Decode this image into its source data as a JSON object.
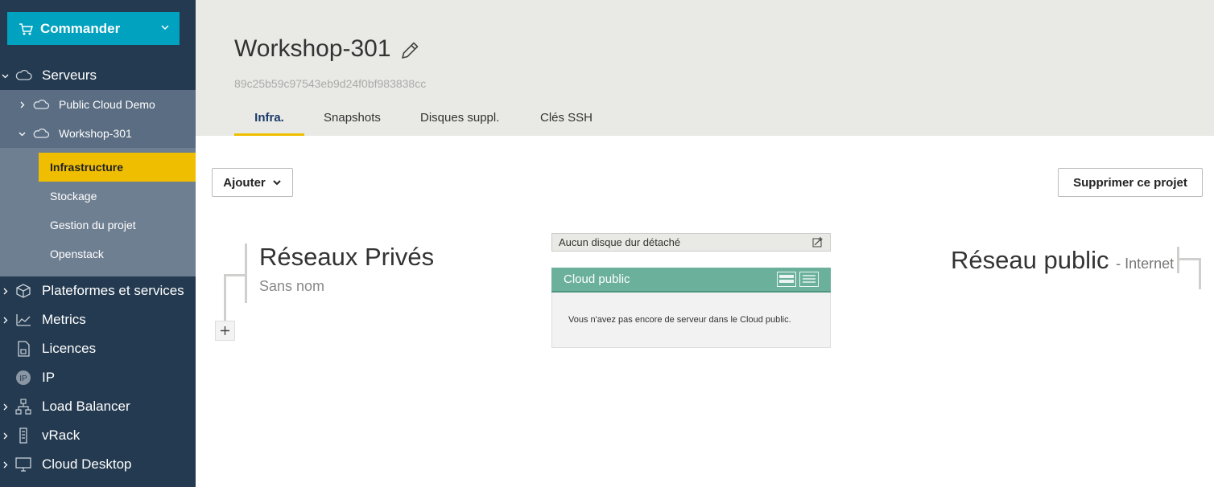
{
  "sidebar": {
    "order_button": "Commander",
    "items": [
      {
        "label": "Serveurs"
      },
      {
        "label": "Public Cloud Demo"
      },
      {
        "label": "Workshop-301"
      },
      {
        "label": "Infrastructure"
      },
      {
        "label": "Stockage"
      },
      {
        "label": "Gestion du projet"
      },
      {
        "label": "Openstack"
      },
      {
        "label": "Plateformes et services"
      },
      {
        "label": "Metrics"
      },
      {
        "label": "Licences"
      },
      {
        "label": "IP"
      },
      {
        "label": "Load Balancer"
      },
      {
        "label": "vRack"
      },
      {
        "label": "Cloud Desktop"
      }
    ]
  },
  "header": {
    "title": "Workshop-301",
    "project_id": "89c25b59c97543eb9d24f0bf983838cc",
    "tabs": [
      {
        "label": "Infra."
      },
      {
        "label": "Snapshots"
      },
      {
        "label": "Disques suppl."
      },
      {
        "label": "Clés SSH"
      }
    ]
  },
  "toolbar": {
    "add_label": "Ajouter",
    "delete_label": "Supprimer ce projet"
  },
  "private_networks": {
    "title": "Réseaux Privés",
    "name": "Sans nom"
  },
  "center": {
    "detached_disks": "Aucun disque dur détaché",
    "cloud_public_title": "Cloud public",
    "empty_message": "Vous n'avez pas encore de serveur dans le Cloud public."
  },
  "public_network": {
    "title": "Réseau public",
    "subtitle": "- Internet"
  },
  "colors": {
    "sidebar_bg": "#243a50",
    "order_button": "#00a2bf",
    "active_item": "#f0be00",
    "cloud_public_header": "#6ab09b"
  }
}
